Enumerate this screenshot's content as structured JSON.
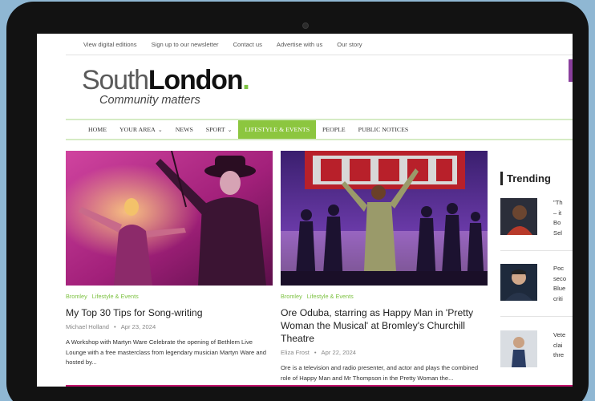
{
  "utility_nav": [
    "View digital editions",
    "Sign up to our newsletter",
    "Contact us",
    "Advertise with us",
    "Our story"
  ],
  "logo": {
    "south": "South",
    "london": "London",
    "dot": ".",
    "tagline": "Community matters"
  },
  "main_nav": [
    {
      "label": "HOME",
      "dropdown": false,
      "active": false
    },
    {
      "label": "YOUR AREA",
      "dropdown": true,
      "active": false
    },
    {
      "label": "NEWS",
      "dropdown": false,
      "active": false
    },
    {
      "label": "SPORT",
      "dropdown": true,
      "active": false
    },
    {
      "label": "LIFESTYLE & EVENTS",
      "dropdown": false,
      "active": true
    },
    {
      "label": "PEOPLE",
      "dropdown": false,
      "active": false
    },
    {
      "label": "PUBLIC NOTICES",
      "dropdown": false,
      "active": false
    }
  ],
  "articles": [
    {
      "categories": [
        "Bromley",
        "Lifestyle & Events"
      ],
      "headline": "My Top 30 Tips for Song-writing",
      "author": "Michael Holland",
      "date": "Apr 23, 2024",
      "excerpt": "A Workshop with Martyn Ware Celebrate the opening of Bethlem Live Lounge with a free masterclass from legendary musician Martyn Ware and hosted by..."
    },
    {
      "categories": [
        "Bromley",
        "Lifestyle & Events"
      ],
      "headline": "Ore Oduba, starring as Happy Man in 'Pretty Woman the Musical' at Bromley's Churchill Theatre",
      "author": "Eliza Frost",
      "date": "Apr 22, 2024",
      "excerpt": "Ore is a television and radio presenter, and actor and plays the combined role of Happy Man and Mr Thompson in the Pretty Woman the..."
    }
  ],
  "trending": {
    "title": "Trending",
    "items": [
      {
        "text": "\"Th\n– it\nBo\nSel"
      },
      {
        "text": "Poc\nseco\nBlue\ncriti"
      },
      {
        "text": "Vete\nclai\nthre"
      }
    ]
  },
  "colors": {
    "accent_green": "#8cc63f",
    "nav_border": "#d5ebc4",
    "brand_pink": "#c2136d",
    "scroll_purple": "#8a3f9d"
  }
}
